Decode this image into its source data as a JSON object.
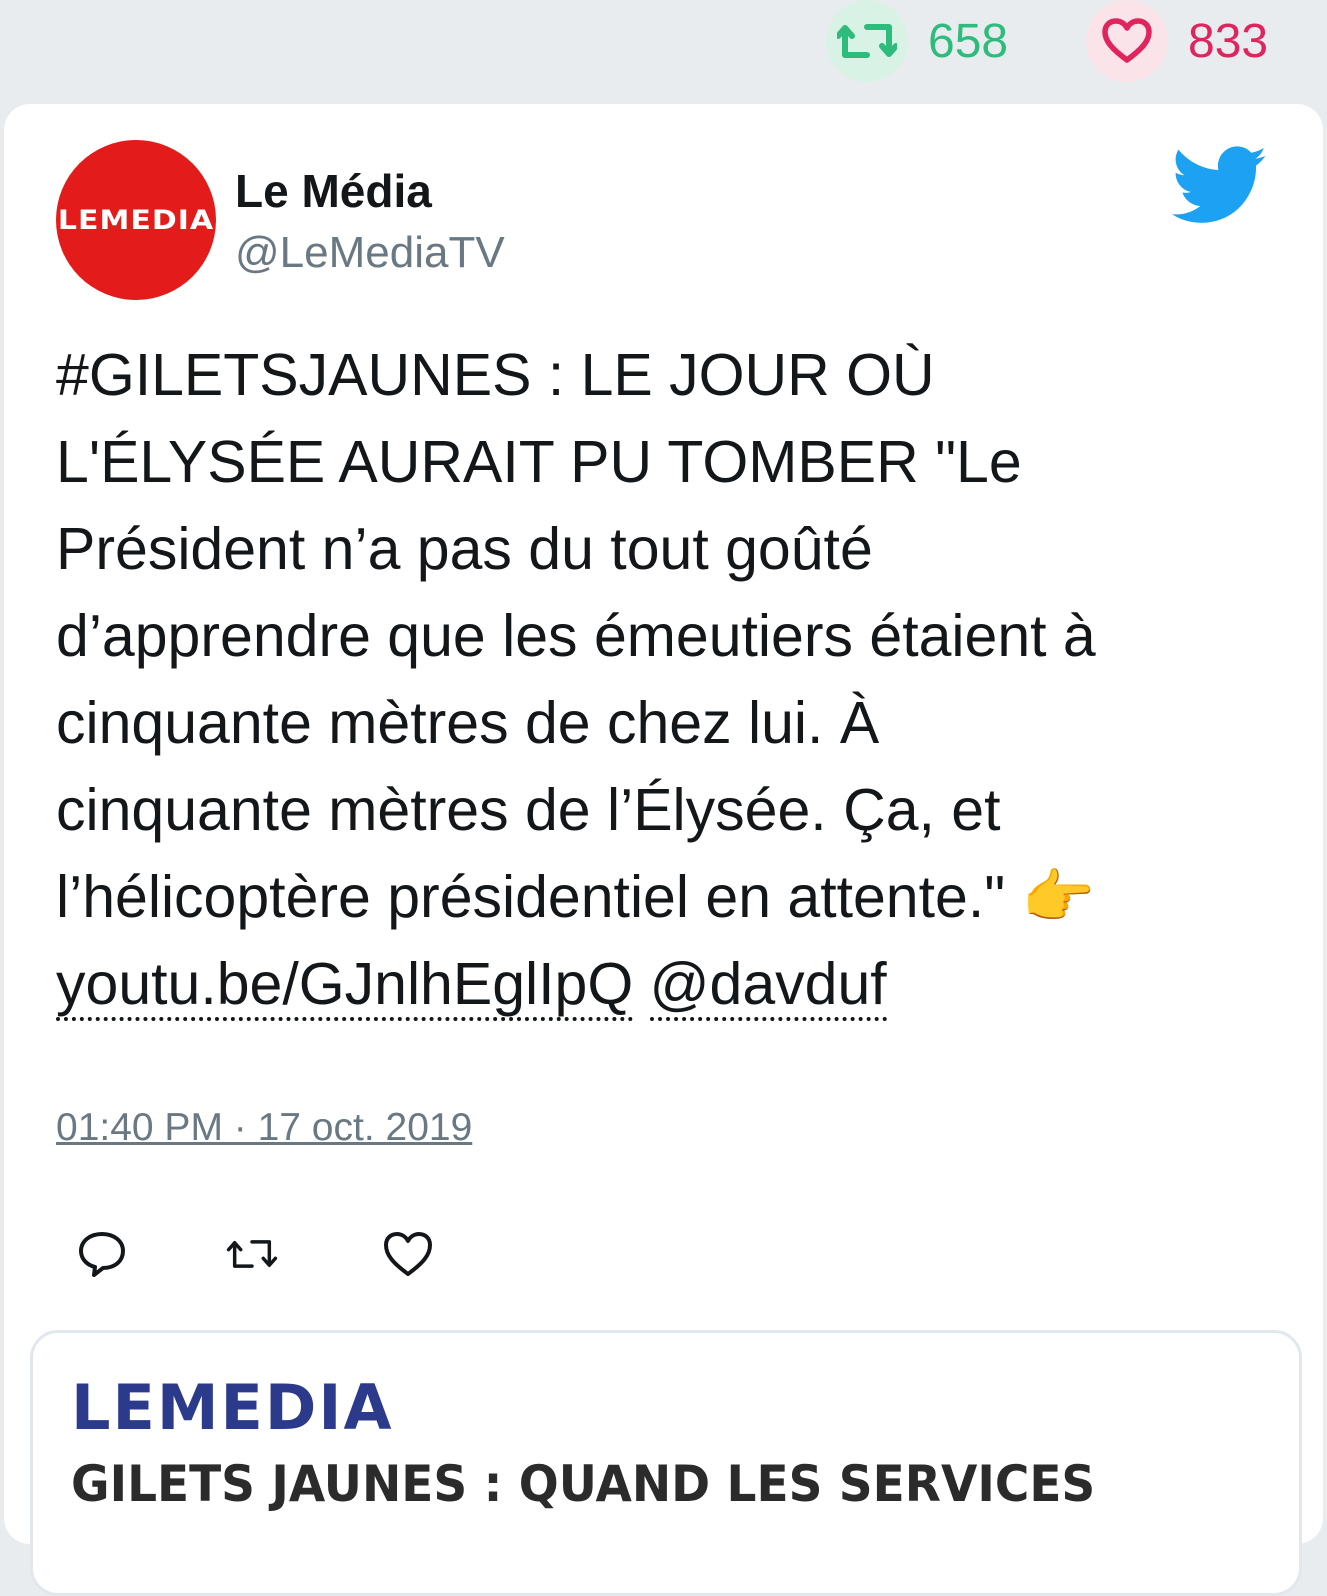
{
  "stats": {
    "retweets": "658",
    "likes": "833"
  },
  "author": {
    "avatar_text": "LEMEDIA",
    "name": "Le Média",
    "handle": "@LeMediaTV"
  },
  "tweet": {
    "lines": [
      "#GILETSJAUNES : LE JOUR OÙ",
      "L'ÉLYSÉE AURAIT PU TOMBER \"Le",
      "Président n’a pas du tout goûté",
      "d’apprendre que les émeutiers étaient à",
      "cinquante mètres de chez lui. À",
      "cinquante mètres de l’Élysée. Ça, et",
      "l’hélicoptère présidentiel en attente.\" 👉"
    ],
    "link": "youtu.be/GJnlhEglIpQ",
    "mention": "@davduf",
    "timestamp": "01:40 PM · 17 oct. 2019"
  },
  "preview": {
    "logo": "LEMEDIA",
    "title": "GILETS JAUNES : QUAND LES SERVICES"
  },
  "colors": {
    "retweet": "#2ebc7c",
    "like": "#e0245e",
    "twitter_blue": "#1da1f2",
    "avatar_red": "#e31b1b"
  },
  "icons": [
    "retweet-icon",
    "heart-icon",
    "twitter-bird-icon",
    "reply-icon"
  ]
}
